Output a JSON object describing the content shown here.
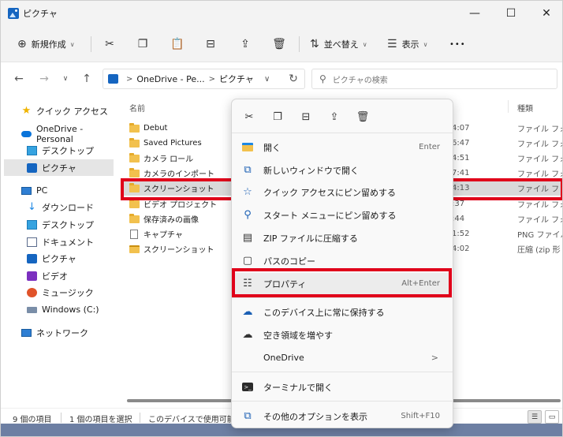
{
  "window": {
    "title": "ピクチャ",
    "minimize": "—",
    "maximize": "☐",
    "close": "✕"
  },
  "toolbar": {
    "new_label": "新規作成",
    "sort_label": "並べ替え",
    "view_label": "表示",
    "more": "•••"
  },
  "address": {
    "crumb_1": "OneDrive - Pe...",
    "crumb_2": "ピクチャ",
    "sep": ">",
    "search_placeholder": "ピクチャの検索"
  },
  "sidebar": {
    "items": [
      {
        "label": "クイック アクセス"
      },
      {
        "label": "OneDrive - Personal"
      },
      {
        "label": "デスクトップ"
      },
      {
        "label": "ピクチャ"
      },
      {
        "label": "PC"
      },
      {
        "label": "ダウンロード"
      },
      {
        "label": "デスクトップ"
      },
      {
        "label": "ドキュメント"
      },
      {
        "label": "ピクチャ"
      },
      {
        "label": "ビデオ"
      },
      {
        "label": "ミュージック"
      },
      {
        "label": "Windows (C:)"
      },
      {
        "label": "ネットワーク"
      }
    ]
  },
  "content": {
    "col_name": "名前",
    "col_type": "種類",
    "files": [
      {
        "name": "Debut",
        "date": "4:07",
        "type": "ファイル フォル"
      },
      {
        "name": "Saved Pictures",
        "date": "6:47",
        "type": "ファイル フォル"
      },
      {
        "name": "カメラ ロール",
        "date": "4:51",
        "type": "ファイル フォル"
      },
      {
        "name": "カメラのインポート",
        "date": "7:41",
        "type": "ファイル フォル"
      },
      {
        "name": "スクリーンショット",
        "date": "4:13",
        "type": "ファイル フォル"
      },
      {
        "name": "ビデオ プロジェクト",
        "date": ":37",
        "type": "ファイル フォル"
      },
      {
        "name": "保存済みの画像",
        "date": ":44",
        "type": "ファイル フォル"
      },
      {
        "name": "キャプチャ",
        "date": "1:52",
        "type": "PNG ファイル"
      },
      {
        "name": "スクリーンショット",
        "date": "4:02",
        "type": "圧縮 (zip 形"
      }
    ]
  },
  "context_menu": {
    "items": [
      {
        "label": "開く",
        "shortcut": "Enter"
      },
      {
        "label": "新しいウィンドウで開く",
        "shortcut": ""
      },
      {
        "label": "クイック アクセスにピン留めする",
        "shortcut": ""
      },
      {
        "label": "スタート メニューにピン留めする",
        "shortcut": ""
      },
      {
        "label": "ZIP ファイルに圧縮する",
        "shortcut": ""
      },
      {
        "label": "パスのコピー",
        "shortcut": ""
      },
      {
        "label": "プロパティ",
        "shortcut": "Alt+Enter"
      },
      {
        "label": "このデバイス上に常に保持する",
        "shortcut": ""
      },
      {
        "label": "空き領域を増やす",
        "shortcut": ""
      },
      {
        "label": "OneDrive",
        "shortcut": ">"
      },
      {
        "label": "ターミナルで開く",
        "shortcut": ""
      },
      {
        "label": "その他のオプションを表示",
        "shortcut": "Shift+F10"
      }
    ]
  },
  "status": {
    "item_count": "9 個の項目",
    "selected": "1 個の項目を選択",
    "availability": "このデバイスで使用可能"
  },
  "colors": {
    "highlight": "#e0001a",
    "accent": "#1565c0",
    "folder": "#f2c14e"
  }
}
